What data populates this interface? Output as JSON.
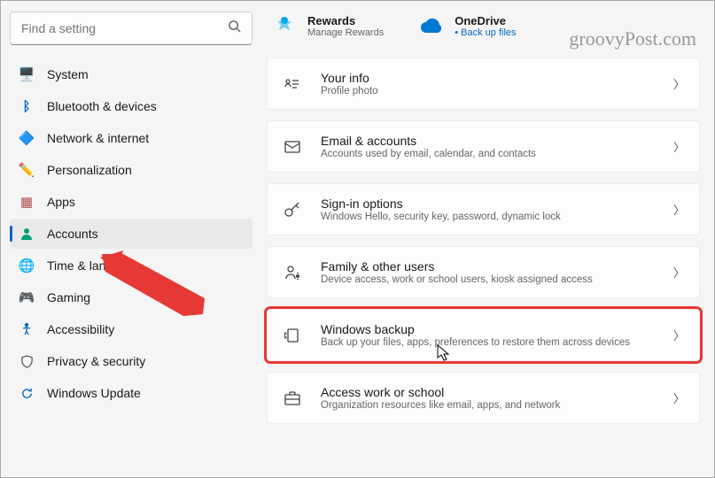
{
  "search": {
    "placeholder": "Find a setting"
  },
  "sidebar": {
    "items": [
      {
        "label": "System",
        "icon": "🖥️",
        "color": "#0067c0"
      },
      {
        "label": "Bluetooth & devices",
        "icon": "ᛒ",
        "color": "#0067c0"
      },
      {
        "label": "Network & internet",
        "icon": "◆",
        "color": "#0090d0"
      },
      {
        "label": "Personalization",
        "icon": "✎",
        "color": "#c04070"
      },
      {
        "label": "Apps",
        "icon": "▦",
        "color": "#b05050"
      },
      {
        "label": "Accounts",
        "icon": "👤",
        "color": "#00a078"
      },
      {
        "label": "Time & language",
        "icon": "🌐",
        "color": "#0078d4"
      },
      {
        "label": "Gaming",
        "icon": "🎮",
        "color": "#888"
      },
      {
        "label": "Accessibility",
        "icon": "⚇",
        "color": "#0067c0"
      },
      {
        "label": "Privacy & security",
        "icon": "🛡",
        "color": "#555"
      },
      {
        "label": "Windows Update",
        "icon": "⟳",
        "color": "#0067c0"
      }
    ]
  },
  "top": {
    "rewards": {
      "title": "Rewards",
      "sub": "Manage Rewards"
    },
    "onedrive": {
      "title": "OneDrive",
      "sub": "Back up files"
    }
  },
  "cards": [
    {
      "title": "Your info",
      "sub": "Profile photo",
      "icon": "id"
    },
    {
      "title": "Email & accounts",
      "sub": "Accounts used by email, calendar, and contacts",
      "icon": "mail"
    },
    {
      "title": "Sign-in options",
      "sub": "Windows Hello, security key, password, dynamic lock",
      "icon": "key"
    },
    {
      "title": "Family & other users",
      "sub": "Device access, work or school users, kiosk assigned access",
      "icon": "family"
    },
    {
      "title": "Windows backup",
      "sub": "Back up your files, apps, preferences to restore them across devices",
      "icon": "backup",
      "highlight": true
    },
    {
      "title": "Access work or school",
      "sub": "Organization resources like email, apps, and network",
      "icon": "briefcase"
    }
  ],
  "watermark": "groovyPost.com"
}
